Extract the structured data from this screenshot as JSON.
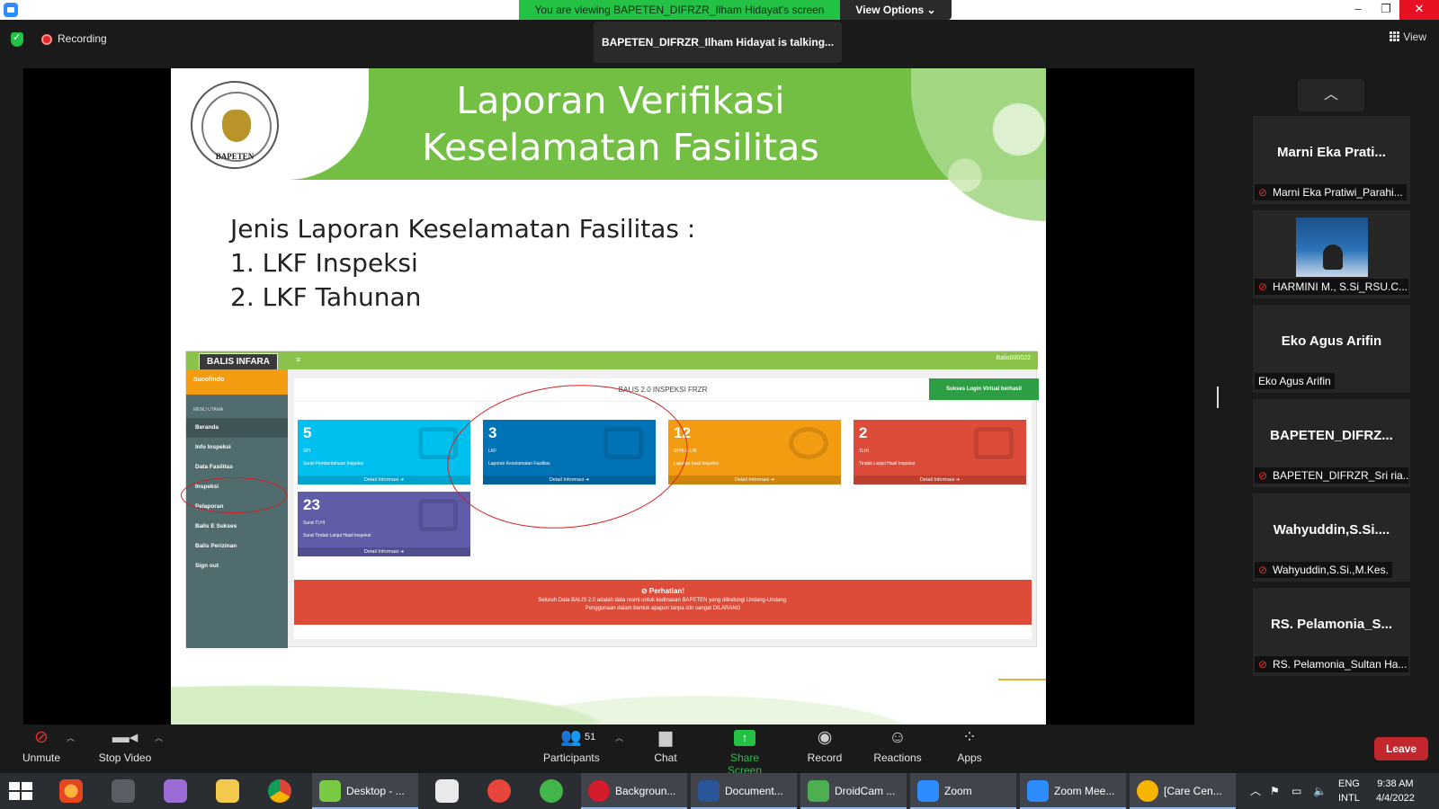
{
  "window": {
    "viewing_banner": "You are viewing BAPETEN_DIFRZR_Ilham Hidayat's screen",
    "view_options": "View Options ⌄",
    "minimize": "–",
    "restore": "❐",
    "close": "✕"
  },
  "topbar": {
    "recording": "Recording",
    "talking": "BAPETEN_DIFRZR_Ilham Hidayat is talking...",
    "view": "View"
  },
  "slide": {
    "title": "Laporan Verifikasi Keselamatan Fasilitas",
    "logo_text": "BAPETEN",
    "heading": "Jenis Laporan Keselamatan Fasilitas :",
    "items": [
      "1.  LKF Inspeksi",
      "2.  LKF Tahunan"
    ]
  },
  "app": {
    "logo": "BALIS INFARA",
    "user": "Balis000022",
    "brand": "Sucofindo",
    "menu_header": "MENU UTAMA",
    "menu": [
      "Beranda",
      "Info Inspeksi",
      "Data Fasilitas",
      "Inspeksi",
      "Pelaporan",
      "Balis E Sukses",
      "Balis Perizinan",
      "Sign out"
    ],
    "page_title": "BALIS 2.0 INSPEKSI FRZR",
    "toast": "Sukses Login Virtual berhasil",
    "cards": [
      {
        "num": "5",
        "abbr": "SPI",
        "desc": "Surat Pemberitahuan Inspeksi",
        "foot": "Detail Informasi ➜",
        "color": "#00c0ef"
      },
      {
        "num": "3",
        "abbr": "LKF",
        "desc": "Laporan Keselamatan Fasilitas",
        "foot": "Detail Informasi ➜",
        "color": "#0073b7"
      },
      {
        "num": "12",
        "abbr": "SPHI & LHI",
        "desc": "Laporan hasil Inspeksi",
        "foot": "Detail Informasi ➜",
        "color": "#f39c12"
      },
      {
        "num": "2",
        "abbr": "TLHI",
        "desc": "Tindak Lanjut Hasil Inspeksi",
        "foot": "Detail Informasi ➜",
        "color": "#dd4b39"
      },
      {
        "num": "23",
        "abbr": "Surat TLHI",
        "desc": "Surat Tindak Lanjut Hasil Inspeksi",
        "foot": "Detail Informasi ➜",
        "color": "#605ca8"
      }
    ],
    "alert_title": "⊘  Perhatian!",
    "alert_line1": "Seluruh Data BALIS 2.0 adalah data resmi untuk kedinasan BAPETEN yang dilindungi Undang-Undang.",
    "alert_line2": "Penggunaan dalam bentuk apapun tanpa izin sangat DILARANG"
  },
  "participants": [
    {
      "name": "Marni  Eka  Prati...",
      "label": "Marni Eka Pratiwi_Parahi...",
      "muted": true,
      "video": false
    },
    {
      "name": "",
      "label": "HARMINI M., S.Si_RSU.C...",
      "muted": true,
      "video": true
    },
    {
      "name": "Eko Agus Arifin",
      "label": "Eko Agus Arifin",
      "muted": false,
      "video": false
    },
    {
      "name": "BAPETEN_DIFRZ...",
      "label": "BAPETEN_DIFRZR_Sri ria...",
      "muted": true,
      "video": false
    },
    {
      "name": "Wahyuddin,S.Si....",
      "label": "Wahyuddin,S.Si.,M.Kes.",
      "muted": true,
      "video": false
    },
    {
      "name": "RS.  Pelamonia_S...",
      "label": "RS. Pelamonia_Sultan Ha...",
      "muted": true,
      "video": false
    }
  ],
  "toolbar": {
    "unmute": "Unmute",
    "stop_video": "Stop Video",
    "participants": "Participants",
    "participants_count": "51",
    "chat": "Chat",
    "share_screen": "Share Screen",
    "record": "Record",
    "reactions": "Reactions",
    "apps": "Apps",
    "leave": "Leave"
  },
  "taskbar": {
    "tasks": [
      "Desktop - ...",
      "Backgroun...",
      "Document...",
      "DroidCam ...",
      "Zoom",
      "Zoom Mee...",
      "[Care Cen..."
    ],
    "lang1": "ENG",
    "lang2": "INTL",
    "time": "9:38 AM",
    "date": "4/4/2022"
  },
  "colors": {
    "zoom_green": "#23c244",
    "slide_green": "#72bf44",
    "leave_red": "#c1272d"
  }
}
